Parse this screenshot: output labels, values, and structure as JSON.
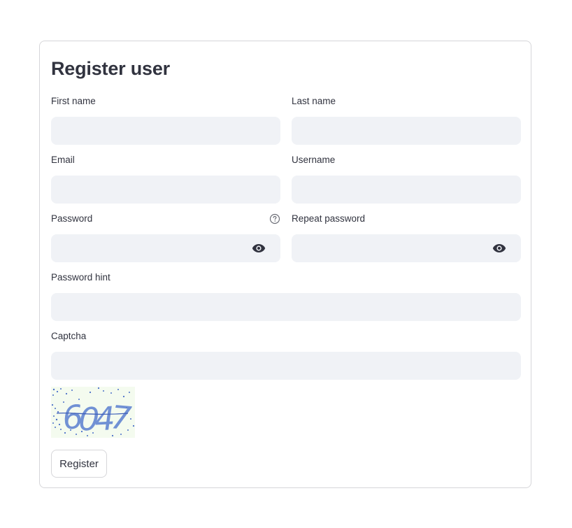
{
  "form": {
    "title": "Register user",
    "fields": {
      "first_name": {
        "label": "First name",
        "value": "",
        "placeholder": ""
      },
      "last_name": {
        "label": "Last name",
        "value": "",
        "placeholder": ""
      },
      "email": {
        "label": "Email",
        "value": "",
        "placeholder": ""
      },
      "username": {
        "label": "Username",
        "value": "",
        "placeholder": ""
      },
      "password": {
        "label": "Password",
        "value": "",
        "placeholder": "",
        "help_icon": "question-circle-icon",
        "toggle_icon": "eye-icon"
      },
      "repeat_password": {
        "label": "Repeat password",
        "value": "",
        "placeholder": "",
        "toggle_icon": "eye-icon"
      },
      "password_hint": {
        "label": "Password hint",
        "value": "",
        "placeholder": ""
      },
      "captcha": {
        "label": "Captcha",
        "value": "",
        "placeholder": ""
      }
    },
    "captcha_image": {
      "text": "6047"
    },
    "submit_label": "Register"
  },
  "colors": {
    "input_background": "#f0f2f6",
    "border": "#d6d6d9",
    "text": "#31333f",
    "captcha_text": "#5b7fd0",
    "captcha_background": "#f4fbef"
  }
}
